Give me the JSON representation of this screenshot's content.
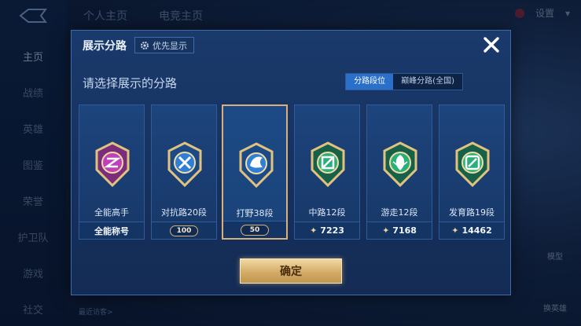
{
  "background": {
    "top_tabs": [
      "个人主页",
      "电竞主页"
    ],
    "sidebar": [
      "主页",
      "战绩",
      "英雄",
      "图鉴",
      "荣誉",
      "护卫队",
      "游戏",
      "社交"
    ],
    "settings_label": "设置",
    "right_labels": [
      "模型",
      "换英雄"
    ],
    "bottom_note": "最近访客>"
  },
  "modal": {
    "title": "展示分路",
    "priority_label": "优先显示",
    "subtitle": "请选择展示的分路",
    "segments": [
      {
        "label": "分路段位",
        "active": true
      },
      {
        "label": "巅峰分路(全国)",
        "active": false
      }
    ],
    "cards": [
      {
        "label": "全能高手",
        "footer": "全能称号",
        "footer_type": "text",
        "icon": "all-round-badge-icon",
        "selected": false
      },
      {
        "label": "对抗路20段",
        "footer": "100",
        "footer_type": "plate",
        "icon": "clash-lane-badge-icon",
        "selected": false
      },
      {
        "label": "打野38段",
        "footer": "50",
        "footer_type": "plate",
        "icon": "jungle-badge-icon",
        "selected": true
      },
      {
        "label": "中路12段",
        "footer": "7223",
        "footer_type": "power",
        "icon": "mid-lane-badge-icon",
        "selected": false
      },
      {
        "label": "游走12段",
        "footer": "7168",
        "footer_type": "power",
        "icon": "roam-badge-icon",
        "selected": false
      },
      {
        "label": "发育路19段",
        "footer": "14462",
        "footer_type": "power",
        "icon": "farm-lane-badge-icon",
        "selected": false
      }
    ],
    "confirm_label": "确定"
  },
  "colors": {
    "accent_gold": "#d9b07a",
    "segment_active": "#2a6fc9",
    "modal_bg": "#1a3a6c"
  }
}
